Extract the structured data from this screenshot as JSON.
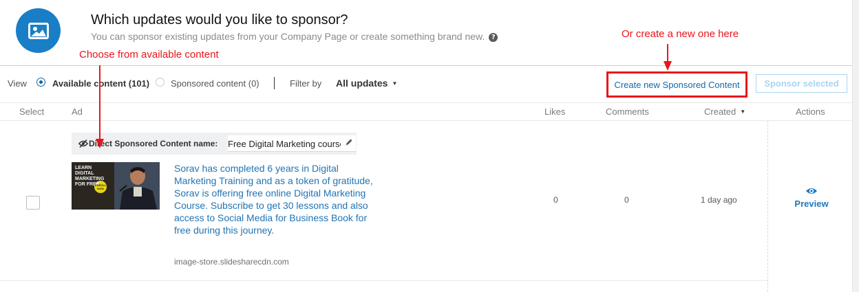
{
  "header": {
    "title": "Which updates would you like to sponsor?",
    "subtitle": "You can sponsor existing updates from your Company Page or create something brand new.",
    "hero_icon": "image-icon",
    "help_icon": "?"
  },
  "toolbar": {
    "view_label": "View",
    "radio_options": [
      {
        "label": "Available content (101)",
        "selected": true
      },
      {
        "label": "Sponsored content (0)",
        "selected": false
      }
    ],
    "filter_label": "Filter by",
    "filter_value": "All updates",
    "create_button": "Create new Sponsored Content",
    "sponsor_button": "Sponsor selected"
  },
  "table": {
    "columns": [
      "Select",
      "Ad",
      "Likes",
      "Comments",
      "Created",
      "Actions"
    ],
    "sorted_column": "Created",
    "rows": [
      {
        "selected": false,
        "name_label": "Direct Sponsored Content name:",
        "name_value": "Free Digital Marketing course",
        "thumbnail_text": "LEARN DIGITAL MARKETING for FREE",
        "thumbnail_badge": "ENROLL NOW",
        "text": "Sorav has completed 6 years in Digital Marketing Training and as a token of gratitude, Sorav is offering free online Digital Marketing Course. Subscribe to get 30 lessons and also access to Social Media for Business Book for free during this journey.",
        "domain": "image-store.slidesharecdn.com",
        "likes": "0",
        "comments": "0",
        "created": "1 day ago",
        "action": "Preview"
      }
    ]
  },
  "annotations": {
    "left": "Choose from available content",
    "right": "Or create a new one here"
  },
  "colors": {
    "accent": "#1a7ec6",
    "link": "#1f74b5",
    "annotation": "#e8141a",
    "disabled_button": "#a9d5ef"
  }
}
